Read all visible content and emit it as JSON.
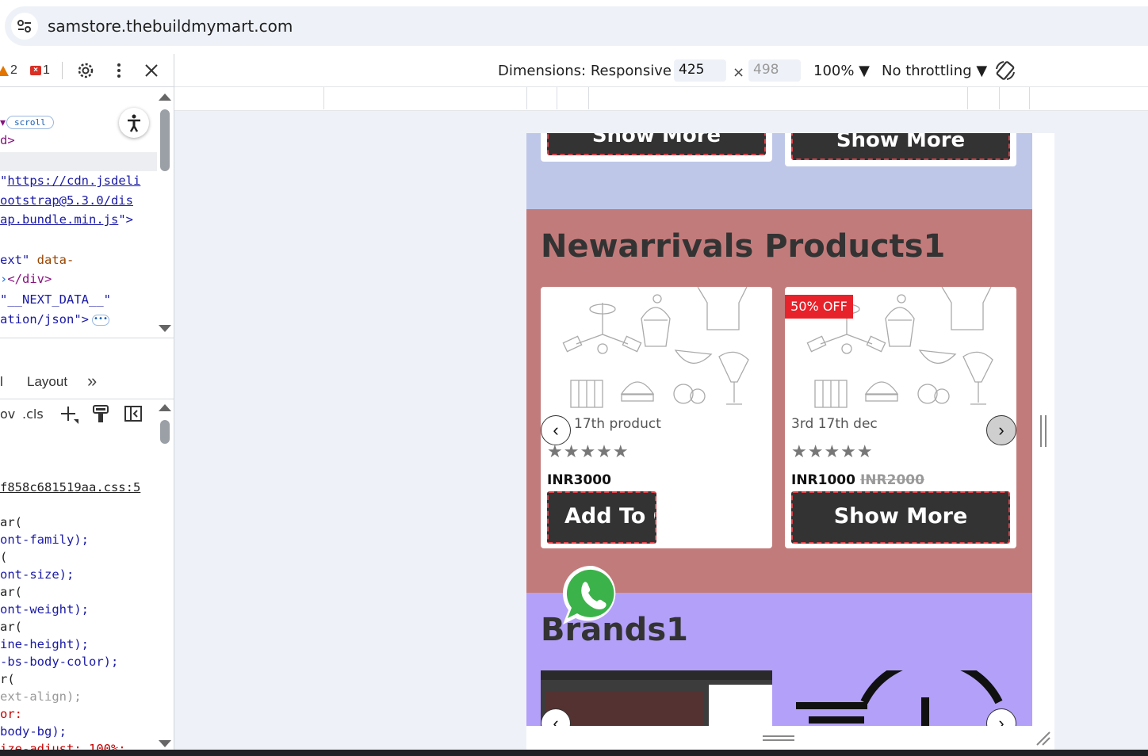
{
  "browser": {
    "url": "samstore.thebuildmymart.com",
    "site_info_icon": "tune-icon"
  },
  "devtools": {
    "warnings_count": "2",
    "errors_count": "1",
    "code_lines": {
      "scroll_badge": "scroll",
      "l1": "d>",
      "l2_prefix": "\"",
      "l2_link": "https://cdn.jsdeli",
      "l3_link": "ootstrap@5.3.0/dis",
      "l4_link": "ap.bundle.min.js",
      "l4_suffix": "\">",
      "l5_attr": "ext\"",
      "l5_rest": " data-",
      "l6": "</div>",
      "l7_str": "\"__NEXT_DATA__\"",
      "l8_str": "ation/json\">"
    },
    "panel_tabs": {
      "left_partial": "l",
      "layout": "Layout",
      "more": "»"
    },
    "styles_toolbar": {
      "hov": "ov",
      "cls": ".cls"
    },
    "css_lines": {
      "file": "f858c681519aa.css:5",
      "c1": "ar(",
      "c2": "ont-family);",
      "c3": "(",
      "c4": "ont-size);",
      "c5": "ar(",
      "c6": "ont-weight);",
      "c7": "ar(",
      "c8": "ine-height);",
      "c9": "-bs-body-color);",
      "c10": "r(",
      "c11": "ext-align);",
      "c12": "or:",
      "c13": "body-bg);",
      "c14": "ize-adjust: 100%;"
    }
  },
  "device_toolbar": {
    "dimensions_label": "Dimensions: Responsive ▼",
    "width": "425",
    "times": "×",
    "height_placeholder": "498",
    "zoom": "100% ▼",
    "throttling": "No throttling ▼"
  },
  "page": {
    "top_buttons": [
      "Show More",
      "Show More"
    ],
    "new_arrivals_title": "Newarrivals Products1",
    "products": [
      {
        "name": "17th product",
        "stars": "★★★★★",
        "price": "INR3000",
        "old_price": "",
        "button": "Add To Cart",
        "badge": ""
      },
      {
        "name": "3rd 17th dec",
        "stars": "★★★★★",
        "price": "INR1000",
        "old_price": "INR2000",
        "button": "Show More",
        "badge": "50% OFF"
      }
    ],
    "prev_arrow": "‹",
    "next_arrow": "›",
    "brands_title": "Brands1"
  },
  "colors": {
    "section_blue": "#bec7e8",
    "section_red": "#c27b7b",
    "section_purple": "#b3a0f8",
    "button_bg": "#333333",
    "button_border": "#e0424a",
    "badge_bg": "#e8222b"
  }
}
